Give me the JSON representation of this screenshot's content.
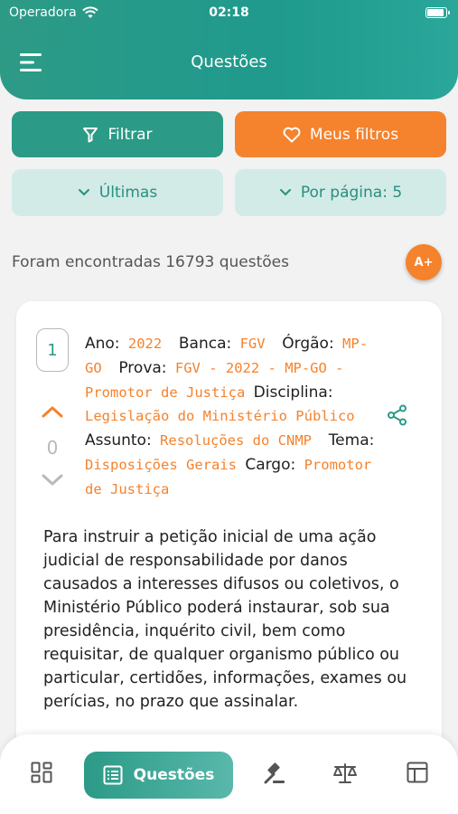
{
  "status_bar": {
    "carrier": "Operadora",
    "time": "02:18"
  },
  "header": {
    "title": "Questões"
  },
  "filters": {
    "filter_label": "Filtrar",
    "my_filters_label": "Meus filtros",
    "sort_label": "Últimas",
    "per_page_label": "Por página: 5"
  },
  "results": {
    "text": "Foram encontradas 16793 questões",
    "font_button": "A+"
  },
  "question": {
    "number": "1",
    "votes": "0",
    "ano_label": "Ano:",
    "ano": "2022",
    "banca_label": "Banca:",
    "banca": "FGV",
    "orgao_label": "Órgão:",
    "orgao": "MP-GO",
    "prova_label": "Prova:",
    "prova": "FGV - 2022 - MP-GO - Promotor de Justiça",
    "disciplina_label": "Disciplina:",
    "disciplina": "Legislação do Ministério Público",
    "assunto_label": "Assunto:",
    "assunto": "Resoluções do CNMP",
    "tema_label": "Tema:",
    "tema": "Disposições Gerais",
    "cargo_label": "Cargo:",
    "cargo": "Promotor de Justiça",
    "statement": "Para instruir a petição inicial de uma ação judicial de responsabilidade por danos causados a interesses difusos ou coletivos, o Ministério Público poderá instaurar, sob sua presidência, inquérito civil, bem como requisitar, de qualquer organismo público ou particular, certidões, informações, exames ou perícias, no prazo que assinalar."
  },
  "bottom_nav": {
    "active_label": "Questões",
    "icons": [
      "dashboard-icon",
      "questions-icon",
      "gavel-icon",
      "scale-icon",
      "table-icon"
    ]
  },
  "colors": {
    "primary": "#2b9a86",
    "accent": "#f5822c",
    "light": "#d2ebe6"
  }
}
